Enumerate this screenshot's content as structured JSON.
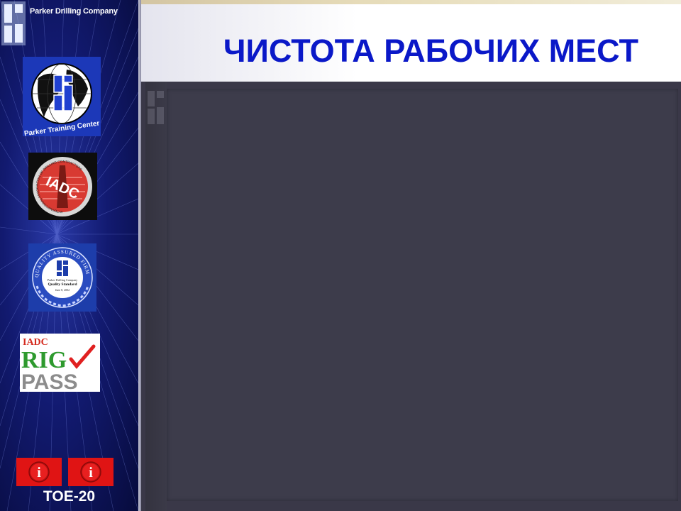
{
  "header": {
    "company": "Parker Drilling Company",
    "title": "ЧИСТОТА РАБОЧИХ МЕСТ"
  },
  "sidebar": {
    "logos": {
      "globe_caption": "Parker Training Center",
      "iadc_ring": "INTERNATIONAL ASSOCIATION OF DRILLING CONTRACTORS",
      "iadc_mark": "IADC",
      "quality_ring": "QUALITY ASSURED FIRM",
      "quality_line1": "Parker Drilling Company",
      "quality_line2": "Quality Standard",
      "quality_date": "June 8, 2002",
      "rigpass_top": "IADC",
      "rigpass_mid": "RIG",
      "rigpass_bottom": "PASS"
    },
    "info_buttons": [
      {
        "label": "i"
      },
      {
        "label": "i"
      }
    ],
    "course_code": "TOE-20"
  },
  "colors": {
    "title": "#0a18c8",
    "sidebar_bg": "#121a70",
    "info_button": "#e01414",
    "content_bg": "#3d3c4b"
  }
}
